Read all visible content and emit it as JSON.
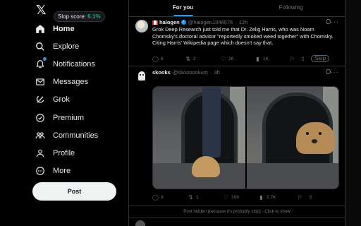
{
  "sidebar": {
    "logo": "𝕏",
    "slop_pill": {
      "label": "Slop score:",
      "value": "6.1%"
    },
    "items": [
      {
        "label": "Home",
        "icon": "home-icon",
        "active": true
      },
      {
        "label": "Explore",
        "icon": "search-icon"
      },
      {
        "label": "Notifications",
        "icon": "bell-icon",
        "badge": true
      },
      {
        "label": "Messages",
        "icon": "envelope-icon"
      },
      {
        "label": "Grok",
        "icon": "grok-icon"
      },
      {
        "label": "Premium",
        "icon": "premium-icon"
      },
      {
        "label": "Communities",
        "icon": "communities-icon"
      },
      {
        "label": "Profile",
        "icon": "person-icon"
      },
      {
        "label": "More",
        "icon": "more-circle-icon"
      }
    ],
    "post_button": "Post"
  },
  "tabs": [
    {
      "label": "For you",
      "active": true
    },
    {
      "label": "Following"
    }
  ],
  "tweets": [
    {
      "name": "halogen",
      "handle": "@halogen1048576",
      "time": "12h",
      "text": "Grok Deep Research just told me that Dr. Zelig Harris, who was Noam Chomsky's doctoral advisor \"reportedly smoked weed together\" with Chomsky. Citing Harris' Wikipedia page which doesn't say that.",
      "replies": "6",
      "retweets": "2",
      "likes": "26",
      "views": "1K",
      "tag": "Slop"
    },
    {
      "name": "skooks",
      "handle": "@skoooookum",
      "time": "3h",
      "replies": "9",
      "retweets": "1",
      "likes": "109",
      "views": "2.7K"
    }
  ],
  "hidden_notice": "Post hidden (because it's probably slop) - Click to show",
  "colors": {
    "accent": "#1d9bf0",
    "slop_green": "#00ba7c",
    "background": "#000000",
    "border": "#2f3336",
    "muted": "#71767b"
  }
}
